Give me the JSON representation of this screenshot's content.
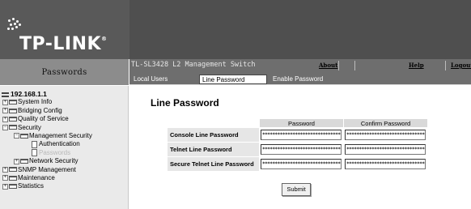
{
  "brand": {
    "logo_text": "TP-LINK",
    "trademark": "®"
  },
  "left_panel": {
    "title": "Passwords"
  },
  "topbar": {
    "switch_name": "TL-SL3428 L2 Management Switch",
    "links": {
      "about": "About",
      "help": "Help",
      "logout": "Logout"
    }
  },
  "tabs": [
    {
      "label": "Local Users",
      "active": false
    },
    {
      "label": "Line Password",
      "active": true
    },
    {
      "label": "Enable Password",
      "active": false
    }
  ],
  "tree": {
    "root": "192.168.1.1",
    "items": [
      {
        "label": "System Info",
        "level": 1,
        "type": "folder"
      },
      {
        "label": "Bridging Config",
        "level": 1,
        "type": "folder"
      },
      {
        "label": "Quality of Service",
        "level": 1,
        "type": "folder"
      },
      {
        "label": "Security",
        "level": 1,
        "type": "folder"
      },
      {
        "label": "Management Security",
        "level": 2,
        "type": "folder"
      },
      {
        "label": "Authentication",
        "level": 3,
        "type": "page"
      },
      {
        "label": "Passwords",
        "level": 3,
        "type": "page",
        "selected": true
      },
      {
        "label": "Network Security",
        "level": 2,
        "type": "folder"
      },
      {
        "label": "SNMP Management",
        "level": 1,
        "type": "folder"
      },
      {
        "label": "Maintenance",
        "level": 1,
        "type": "folder"
      },
      {
        "label": "Statistics",
        "level": 1,
        "type": "folder"
      }
    ]
  },
  "main": {
    "title": "Line Password",
    "columns": [
      "Password",
      "Confirm Password"
    ],
    "rows": [
      {
        "label": "Console Line Password",
        "password": "********************************",
        "confirm": "********************************"
      },
      {
        "label": "Telnet Line Password",
        "password": "********************************",
        "confirm": "********************************"
      },
      {
        "label": "Secure Telnet Line Password",
        "password": "********************************",
        "confirm": "********************************"
      }
    ],
    "submit_label": "Submit"
  },
  "colors": {
    "header_bg": "#595959",
    "bar_bg": "#6e6e6e",
    "tree_bg": "#eaeaea",
    "table_header_bg": "#d9d9d9"
  }
}
